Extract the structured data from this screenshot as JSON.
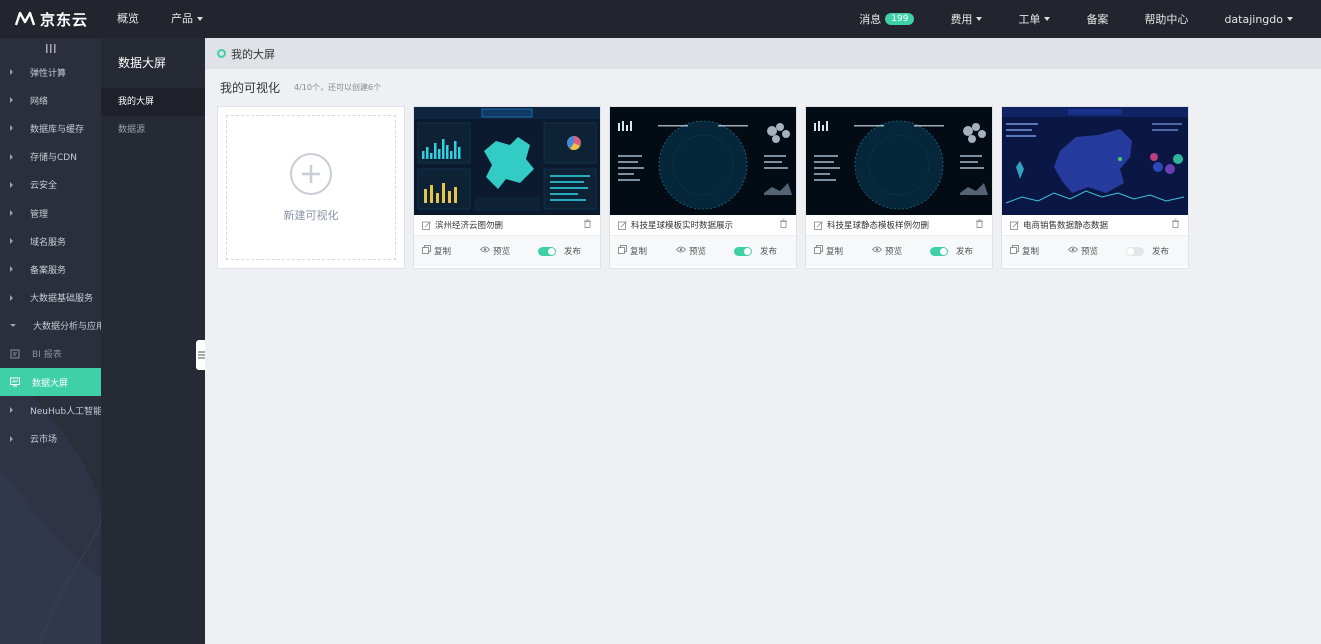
{
  "header": {
    "logo_text": "京东云",
    "nav": [
      "概览",
      "产品"
    ],
    "right": {
      "messages_label": "消息",
      "messages_count": "199",
      "billing": "费用",
      "tickets": "工单",
      "filing": "备案",
      "help": "帮助中心",
      "user": "datajingdo"
    }
  },
  "sidebar": {
    "items": [
      {
        "label": "弹性计算"
      },
      {
        "label": "网络"
      },
      {
        "label": "数据库与缓存"
      },
      {
        "label": "存储与CDN"
      },
      {
        "label": "云安全"
      },
      {
        "label": "管理"
      },
      {
        "label": "域名服务"
      },
      {
        "label": "备案服务"
      },
      {
        "label": "大数据基础服务"
      },
      {
        "label": "大数据分析与应用"
      },
      {
        "label": "BI 报表"
      },
      {
        "label": "数据大屏"
      },
      {
        "label": "NeuHub人工智能"
      },
      {
        "label": "云市场"
      }
    ]
  },
  "sidebar2": {
    "title": "数据大屏",
    "items": [
      "我的大屏",
      "数据源"
    ]
  },
  "main": {
    "breadcrumb": "我的大屏",
    "section_title": "我的可视化",
    "section_sub": "4/10个，还可以创建6个",
    "new_card_label": "新建可视化",
    "cards": [
      {
        "title": "滨州经济云图勿删",
        "copy": "复制",
        "preview": "预览",
        "publish": "发布",
        "published": true
      },
      {
        "title": "科技星球模板实时数据展示",
        "copy": "复制",
        "preview": "预览",
        "publish": "发布",
        "published": true
      },
      {
        "title": "科技星球静态模板样例勿删",
        "copy": "复制",
        "preview": "预览",
        "publish": "发布",
        "published": true
      },
      {
        "title": "电商销售数据静态数据",
        "copy": "复制",
        "preview": "预览",
        "publish": "发布",
        "published": false
      }
    ]
  },
  "colors": {
    "accent": "#3fd0a8",
    "topbar": "#22252e",
    "sidebar": "#2b2f3b"
  }
}
